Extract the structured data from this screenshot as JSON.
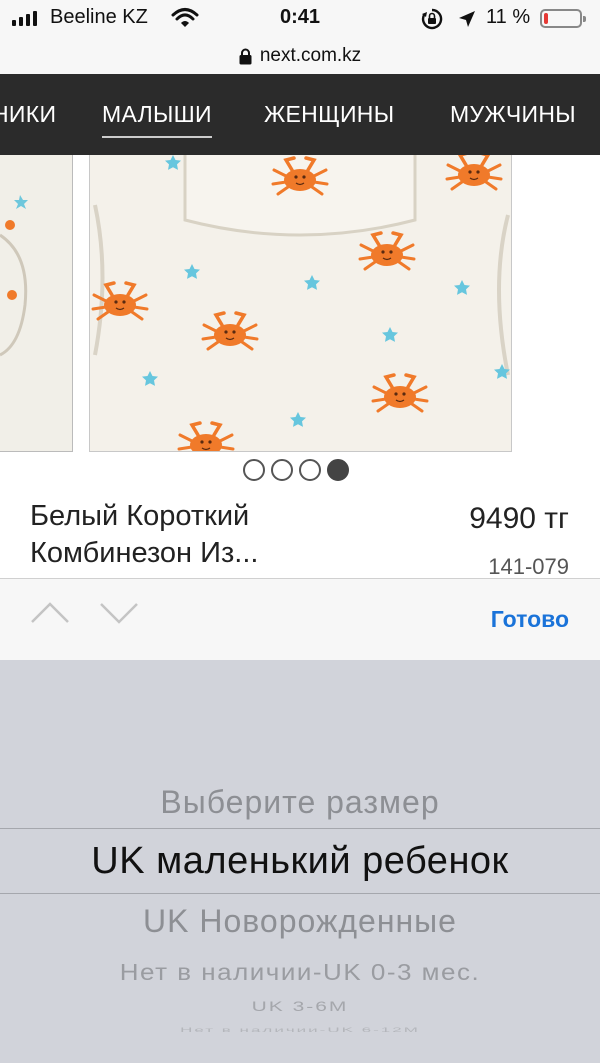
{
  "status_bar": {
    "carrier": "Beeline KZ",
    "time": "0:41",
    "battery_percent": "11 %",
    "battery_level": 0.11,
    "battery_color": "#e53935",
    "icons": [
      "signal-bars-icon",
      "wifi-icon",
      "rotation-lock-icon",
      "location-arrow-icon",
      "battery-icon"
    ]
  },
  "browser": {
    "url": "next.com.kz",
    "lock_icon": "padlock-icon"
  },
  "nav": {
    "items": [
      {
        "label": "НИКИ",
        "active": false
      },
      {
        "label": "МАЛЫШИ",
        "active": true
      },
      {
        "label": "ЖЕНЩИНЫ",
        "active": false
      },
      {
        "label": "МУЖЧИНЫ",
        "active": false
      }
    ],
    "background": "#2b2b2b"
  },
  "product": {
    "name": "Белый Короткий Комбинезон Из...",
    "price": "9490 тг",
    "sku": "141-079",
    "images": {
      "count": 4,
      "active_index": 3
    }
  },
  "toolbar": {
    "prev_icon": "chevron-up-icon",
    "next_icon": "chevron-down-icon",
    "done_label": "Готово",
    "done_color": "#1a73d9"
  },
  "picker": {
    "options": [
      "Выберите размер",
      "UK маленький ребенок",
      "UK Новорожденные",
      "Нет в наличии-UK 0-3 мес.",
      "UK 3-6M",
      "Нет в наличии-UK 6-12M"
    ],
    "selected": "UK маленький ребенок"
  }
}
